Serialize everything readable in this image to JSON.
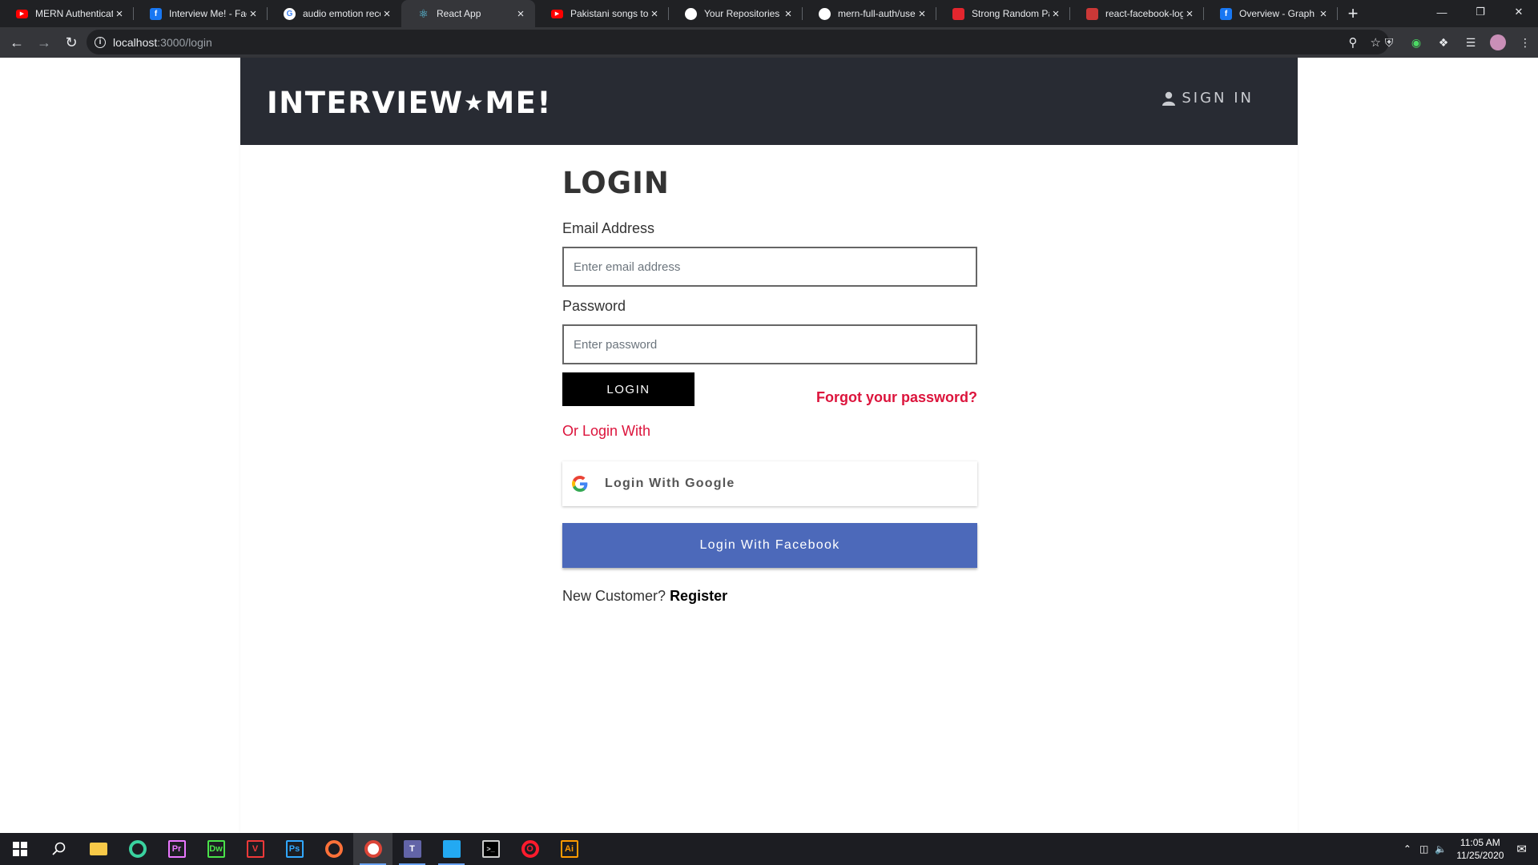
{
  "browser": {
    "tabs": [
      {
        "title": "MERN Authenticati",
        "icon": "youtube-icon",
        "color": "#ff0000"
      },
      {
        "title": "Interview Me! - Face",
        "icon": "facebook-icon",
        "color": "#1877f2"
      },
      {
        "title": "audio emotion reco",
        "icon": "google-icon",
        "color": "#ffffff"
      },
      {
        "title": "React App",
        "icon": "react-icon",
        "color": "#61dafb",
        "active": true
      },
      {
        "title": "Pakistani songs to li",
        "icon": "youtube-icon",
        "color": "#ff0000"
      },
      {
        "title": "Your Repositories",
        "icon": "github-icon",
        "color": "#ffffff"
      },
      {
        "title": "mern-full-auth/use",
        "icon": "github-icon",
        "color": "#ffffff"
      },
      {
        "title": "Strong Random Pa",
        "icon": "password-icon",
        "color": "#e3262e"
      },
      {
        "title": "react-facebook-log",
        "icon": "npm-icon",
        "color": "#cb3837"
      },
      {
        "title": "Overview - Graph A",
        "icon": "facebook-icon",
        "color": "#1877f2"
      }
    ],
    "url_host": "localhost",
    "url_path": ":3000/login"
  },
  "header": {
    "logo_left": "INTERVIEW",
    "logo_star": "★",
    "logo_right": "ME!",
    "signin_label": "SIGN IN"
  },
  "form": {
    "title": "LOGIN",
    "email_label": "Email Address",
    "email_placeholder": "Enter email address",
    "password_label": "Password",
    "password_placeholder": "Enter password",
    "login_button": "LOGIN",
    "forgot_link": "Forgot your password?",
    "or_login_with": "Or Login With",
    "google_button": "Login With Google",
    "facebook_button": "Login With Facebook",
    "new_customer": "New Customer?",
    "register_link": "Register"
  },
  "colors": {
    "header_bg": "#282b33",
    "accent_red": "#dc143c",
    "facebook_blue": "#4c69ba"
  },
  "taskbar": {
    "apps": [
      {
        "name": "file-explorer-icon",
        "label": "",
        "color": "#f7c948"
      },
      {
        "name": "gitkraken-icon",
        "label": "",
        "color": "#3ad29f"
      },
      {
        "name": "premiere-icon",
        "label": "Pr",
        "color": "#ea77ff"
      },
      {
        "name": "dreamweaver-icon",
        "label": "Dw",
        "color": "#4ae34a"
      },
      {
        "name": "vivaldi-icon",
        "label": "V",
        "color": "#ef3939"
      },
      {
        "name": "photoshop-icon",
        "label": "Ps",
        "color": "#31a8ff"
      },
      {
        "name": "firefox-icon",
        "label": "",
        "color": "#ff7139"
      },
      {
        "name": "chrome-icon",
        "label": "",
        "color": "#4285f4",
        "active": true
      },
      {
        "name": "teams-icon",
        "label": "T",
        "color": "#6264a7"
      },
      {
        "name": "vscode-icon",
        "label": "",
        "color": "#23a9f2"
      },
      {
        "name": "terminal-icon",
        "label": ">_",
        "color": "#cccccc"
      },
      {
        "name": "opera-icon",
        "label": "O",
        "color": "#ff1b2d"
      },
      {
        "name": "illustrator-icon",
        "label": "Ai",
        "color": "#ff9a00"
      }
    ],
    "time": "11:05 AM",
    "date": "11/25/2020"
  }
}
